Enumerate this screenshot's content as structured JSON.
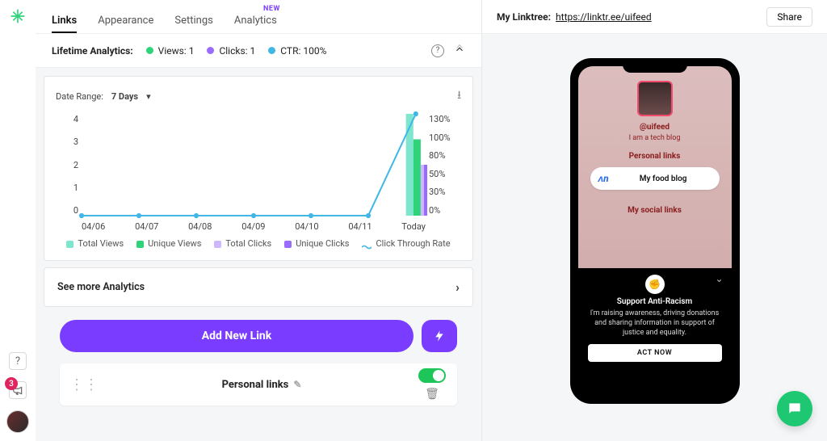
{
  "colors": {
    "purple": "#7a3cff",
    "teal": "#7ee6cf",
    "green": "#2fd37a",
    "lavender": "#cdb8ff",
    "violet": "#9a6bff",
    "blue": "#42b7e6"
  },
  "nav": {
    "tabs": {
      "links": "Links",
      "appearance": "Appearance",
      "settings": "Settings",
      "analytics": "Analytics",
      "new_tag": "NEW"
    },
    "active": "links"
  },
  "analytics_header": {
    "label": "Lifetime Analytics:",
    "views": "Views: 1",
    "clicks": "Clicks: 1",
    "ctr": "CTR: 100%"
  },
  "date_range": {
    "label": "Date Range:",
    "value": "7 Days"
  },
  "chart_data": {
    "type": "bar+line",
    "categories": [
      "04/06",
      "04/07",
      "04/08",
      "04/09",
      "04/10",
      "04/11",
      "Today"
    ],
    "y_left_ticks": [
      4,
      3,
      2,
      1,
      0
    ],
    "y_right_ticks": [
      "130%",
      "100%",
      "80%",
      "50%",
      "30%",
      "0%"
    ],
    "series": [
      {
        "name": "Total Views",
        "color": "#7ee6cf",
        "values": [
          0,
          0,
          0,
          0,
          0,
          0,
          4
        ]
      },
      {
        "name": "Unique Views",
        "color": "#2fd37a",
        "values": [
          0,
          0,
          0,
          0,
          0,
          0,
          3
        ]
      },
      {
        "name": "Total Clicks",
        "color": "#cdb8ff",
        "values": [
          0,
          0,
          0,
          0,
          0,
          0,
          2
        ]
      },
      {
        "name": "Unique Clicks",
        "color": "#9a6bff",
        "values": [
          0,
          0,
          0,
          0,
          0,
          0,
          2
        ]
      },
      {
        "name": "Click Through Rate",
        "color": "#42b7e6",
        "type": "line",
        "values_pct": [
          0,
          0,
          0,
          0,
          0,
          0,
          130
        ]
      }
    ]
  },
  "legend": {
    "total_views": "Total Views",
    "unique_views": "Unique Views",
    "total_clicks": "Total Clicks",
    "unique_clicks": "Unique Clicks",
    "ctr": "Click Through Rate"
  },
  "see_more": "See more Analytics",
  "buttons": {
    "add_link": "Add New Link"
  },
  "link_card": {
    "title": "Personal links"
  },
  "right": {
    "label": "My Linktree:",
    "url": "https://linktr.ee/uifeed",
    "share": "Share"
  },
  "preview": {
    "handle": "@uifeed",
    "tagline": "I am a tech blog",
    "section1": "Personal links",
    "link1": "My food blog",
    "section2": "My social links",
    "banner": {
      "title": "Support Anti-Racism",
      "desc": "I'm raising awareness, driving donations and sharing information in support of justice and equality.",
      "cta": "ACT NOW"
    }
  },
  "rail": {
    "badge": "3"
  }
}
